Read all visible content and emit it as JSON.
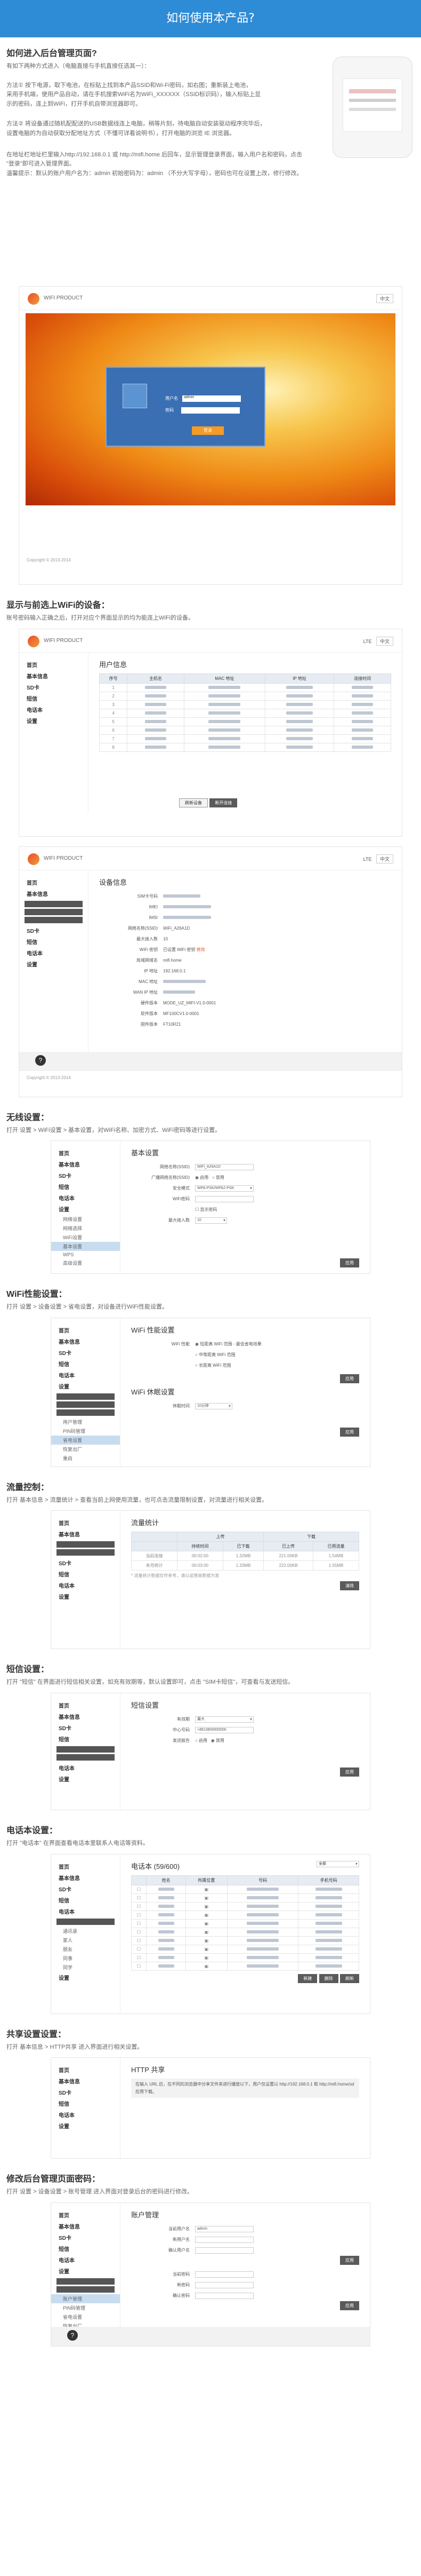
{
  "header": {
    "title": "如何使用本产品?"
  },
  "intro": {
    "heading": "如何进入后台管理页面?",
    "lines": [
      "有如下两种方式进入（电脑直接与手机直接任选其一）：",
      "方法①  按下电源，取下电池，在标贴上找到本产品SSID和Wi-Fi密码，如右图；重新装上电池，",
      "采用手机端，使用产品自动，请在手机搜索WiFi名为WiFi_XXXXXX（SSID标识码），输入标贴上显",
      "示的密码，连上到WiFi，打开手机自带浏览器即可。",
      "方法② 将设备通过随机配配送的USB数据线连上电脑，稍等片刻，待电脑自动安装驱动程序完毕后，",
      "设置电脑的为自动获取分配地址方式（不懂可详看说明书），打开电脑的浏览 IE 浏览器。",
      "在地址栏地址栏里输入http://192.168.0.1 或 http://mifi.home 后回车，显示管理登录界面，输入用户名和密码，点击",
      "\"登录\"即可进入管理界面。",
      "温馨提示：默认的账户用户名为：admin 初始密码为：admin （不分大写字母），密码也可在设置上改，修行修改。"
    ]
  },
  "brand": "WIFI PRODUCT",
  "login": {
    "user_label": "用户名",
    "pass_label": "密码",
    "user_value": "admin",
    "button": "登录"
  },
  "copyright": "Copyright © 2013-2014",
  "lang": "中文",
  "status": "LTE",
  "sec2": {
    "heading": "显示与前选上WiFi的设备：",
    "line": "账号密码输入正确之后，打开对应个界面显示的均为能连上WiFi的设备。"
  },
  "nav": {
    "home": "首页",
    "basic": "基本信息",
    "sd": "SD卡",
    "sms": "短信",
    "phonebook": "电话本",
    "settings": "设置",
    "logout": "退出"
  },
  "users": {
    "title": "用户信息",
    "cols": [
      "序号",
      "主机名",
      "MAC 地址",
      "IP 地址",
      "连接时间"
    ],
    "buttons": [
      "刷新设备",
      "断开连接"
    ]
  },
  "devinfo": {
    "title": "设备信息",
    "keys": [
      "SIM卡号码",
      "IMEI",
      "IMSI",
      "网络名称(SSID)",
      "最大接入数",
      "WiFi 密钥",
      "局域网域名",
      "IP 地址",
      "MAC 地址",
      "WAN IP 地址",
      "硬件版本",
      "软件版本",
      "固件版本"
    ],
    "ssid": "WiFi_A26A1D",
    "maxnum": "10",
    "wifi_key": "已设置 WiFi 密钥",
    "wifi_key_link": "修改",
    "domain": "mifi.home",
    "ip": "192.168.0.1",
    "hw": "MODE_UZ_MIFI-V1.0-0001",
    "sw": "MF100CV1.0-0001",
    "fw": "FT10R21"
  },
  "sec3": {
    "heading": "无线设置：",
    "line": "打开 设置 > WiFi设置 > 基本设置，对WiFi名称、加密方式、WiFi密码等进行设置。"
  },
  "basic": {
    "title": "基本设置",
    "keys": [
      "网络名称(SSID)",
      "广播网络名称(SSID)",
      "安全模式",
      "WiFi密码",
      "",
      "最大接入数"
    ],
    "ssid": "WiFi_A26A1D",
    "bc_on": "启用",
    "bc_off": "禁用",
    "mode": "WPA-PSK/WPA2-PSK",
    "show_pw": "显示密码",
    "max": "10",
    "apply": "应用",
    "menu": [
      "网络设置",
      "网络选择",
      "WiFi设置",
      "基本设置",
      "WPS",
      "高级设置"
    ]
  },
  "sec4": {
    "heading": "WiFi性能设置：",
    "line": "打开 设置 > 设备设置 > 省电设置，对设备进行WiFi性能设置。"
  },
  "perf": {
    "title": "WiFi 性能设置",
    "label": "WiFi 性能",
    "opts": [
      "短距离 WiFi 范围 - 最佳省电效果",
      "中等距离 WiFi 范围",
      "长距离 WiFi 范围"
    ],
    "sleep_title": "WiFi 休眠设置",
    "sleep_label": "休眠时间",
    "sleep_value": "10分钟",
    "apply": "应用",
    "menu": [
      "用户管理",
      "PIN码管理",
      "省电设置",
      "恢复出厂",
      "重启"
    ]
  },
  "sec5": {
    "heading": "流量控制：",
    "line": "打开 基本信息 > 流量统计 > 查看当前上网使用流量，也可点击流量限制设置，对流量进行相关设置。"
  },
  "traffic": {
    "title": "流量统计",
    "cols": [
      "",
      "持续时间",
      "已下载",
      "已上传",
      "已用流量"
    ],
    "up": "上传",
    "down": "下载",
    "rows": [
      [
        "当前连接",
        "00:02:00",
        "1.32MB",
        "221.00KB",
        "1.54MB"
      ],
      [
        "本月统计",
        "00:03:00",
        "1.33MB",
        "222.00KB",
        "1.55MB"
      ]
    ],
    "note": "* 流量统计数据仅作参考，请以运营商数据为准",
    "reset": "清除"
  },
  "sec6": {
    "heading": "短信设置：",
    "line": "打开 \"短信\" 在界面进行短信相关设置，如充有效期等，默认设置即可，点击 \"SIM卡短信\"，可查看与发送短信。"
  },
  "sms": {
    "title": "短信设置",
    "keys": [
      "有效期",
      "中心号码",
      "发送报告"
    ],
    "validity": "最大",
    "center": "+8613800000000",
    "on": "启用",
    "off": "禁用",
    "apply": "应用"
  },
  "sec7": {
    "heading": "电话本设置：",
    "line": "打开 \"电话本\" 在界面查看电话本里联系人电话等资料。"
  },
  "pb": {
    "title": "电话本 (59/600)",
    "filter": "全部",
    "cols": [
      "",
      "姓名",
      "所属位置",
      "号码",
      "手机号码"
    ],
    "menu": [
      "全部",
      "通讯录",
      "家人",
      "朋友",
      "同事",
      "同学"
    ],
    "buttons": [
      "新建",
      "删除",
      "刷新"
    ]
  },
  "sec8": {
    "heading": "共享设置设置：",
    "line": "打开 基本信息 > HTTP共享 进入界面进行相关设置。"
  },
  "http": {
    "title": "HTTP 共享",
    "note": "在输入 URL 后，在不同的浏览器中分享文件夹进行播放以下，用户仅设置以 http://192.168.0.1 和 http://mifi.home/sd 应用下载。"
  },
  "sec9": {
    "heading": "修改后台管理页面密码：",
    "line": "打开 设置 > 设备设置 > 账号管理 进入界面对登录后台的密码进行修改。"
  },
  "account": {
    "title": "账户管理",
    "keys": [
      "当前用户名",
      "新用户名",
      "确认用户名"
    ],
    "keys2": [
      "当前密码",
      "新密码",
      "确认密码"
    ],
    "user": "admin",
    "apply": "应用",
    "menu": [
      "账户管理",
      "PIN码管理",
      "省电设置",
      "恢复出厂",
      "重启"
    ]
  }
}
